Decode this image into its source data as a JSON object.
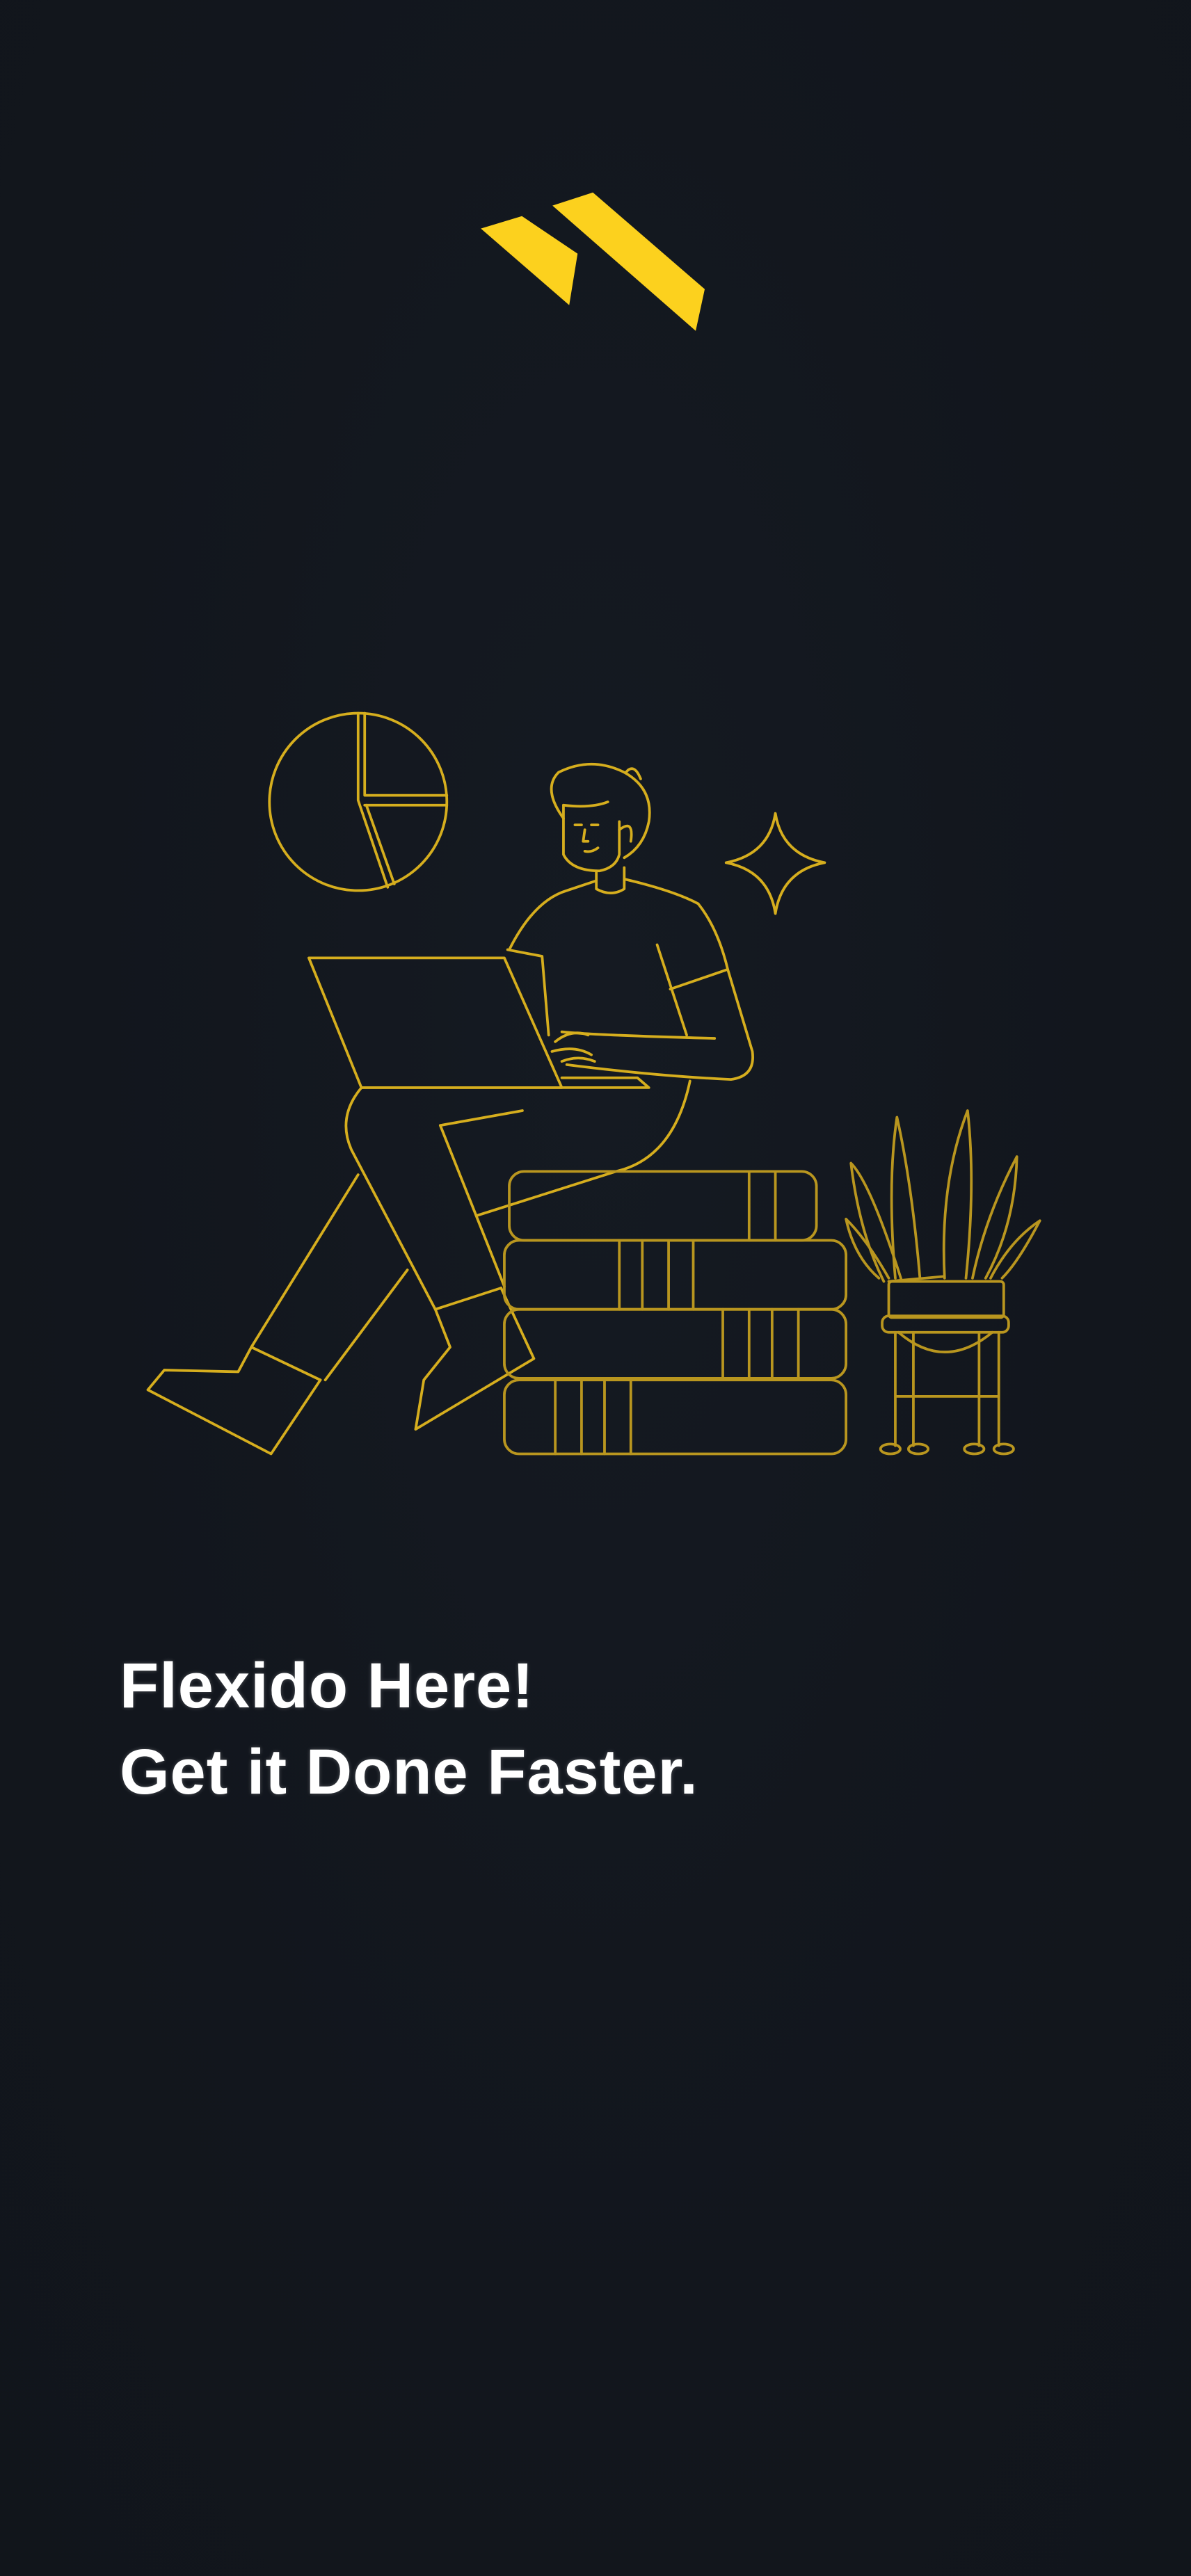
{
  "brand": {
    "name": "Flexido",
    "logo_icon": "double-stripe-logo-icon",
    "accent_color": "#fcd11e"
  },
  "illustration": {
    "subject": "person-with-laptop-on-books-icon",
    "stroke_color": "#d6ae1e"
  },
  "headline": {
    "line1": "Flexido Here!",
    "line2": "Get it Done Faster."
  },
  "colors": {
    "background": "#12161d",
    "text": "#ffffff"
  }
}
